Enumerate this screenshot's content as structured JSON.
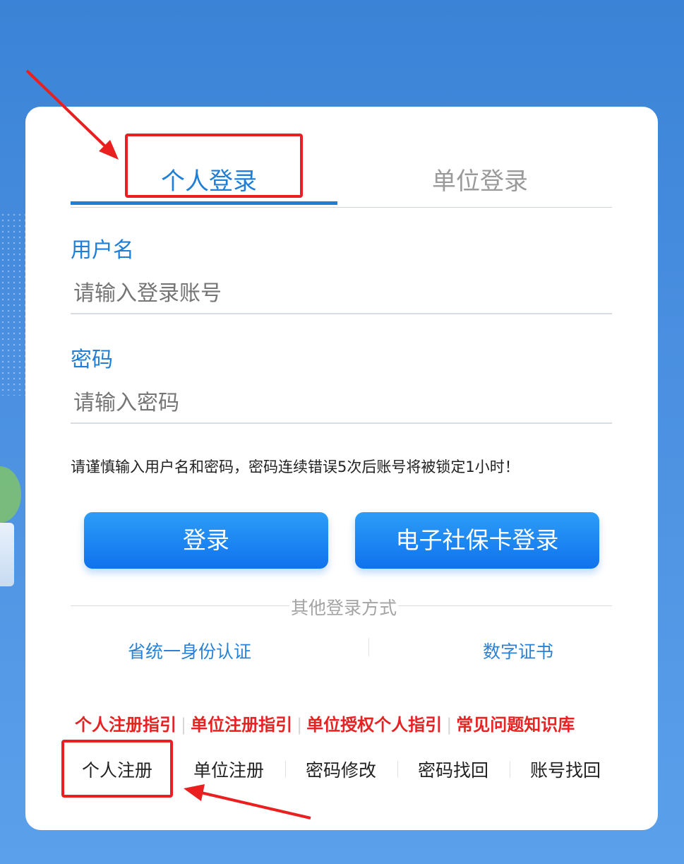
{
  "tabs": {
    "personal": "个人登录",
    "unit": "单位登录"
  },
  "form": {
    "username_label": "用户名",
    "username_placeholder": "请输入登录账号",
    "password_label": "密码",
    "password_placeholder": "请输入密码",
    "notice": "请谨慎输入用户名和密码，密码连续错误5次后账号将被锁定1小时！"
  },
  "buttons": {
    "login": "登录",
    "ssc_login": "电子社保卡登录"
  },
  "alt_login": {
    "label": "其他登录方式",
    "provincial": "省统一身份认证",
    "digital_cert": "数字证书"
  },
  "guides": [
    "个人注册指引",
    "单位注册指引",
    "单位授权个人指引",
    "常见问题知识库"
  ],
  "bottom_links": [
    "个人注册",
    "单位注册",
    "密码修改",
    "密码找回",
    "账号找回"
  ],
  "colors": {
    "accent": "#1f7fd6",
    "button": "#1f86f2",
    "guide_red": "#e62222",
    "annotation_red": "#ea1f1f",
    "background": "#4a8fe0"
  }
}
